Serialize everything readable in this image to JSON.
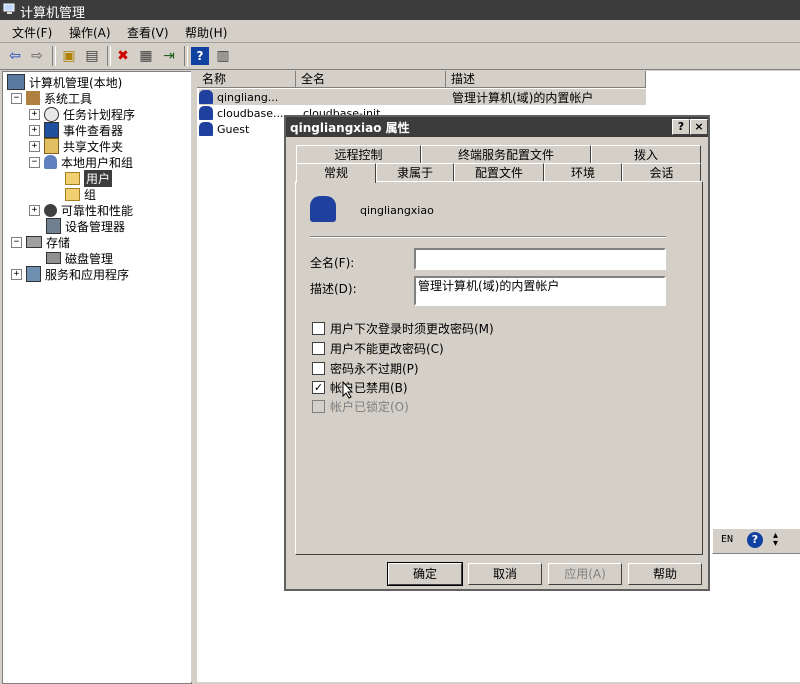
{
  "window": {
    "title": "计算机管理"
  },
  "menu": [
    "文件(F)",
    "操作(A)",
    "查看(V)",
    "帮助(H)"
  ],
  "toolbar": {
    "buttons": [
      {
        "name": "back-arrow-icon",
        "glyph": "⇦"
      },
      {
        "name": "forward-arrow-icon",
        "glyph": "⇨"
      },
      {
        "name": "up-folder-icon",
        "glyph": "▣"
      },
      {
        "name": "show-hide-tree-icon",
        "glyph": "▤"
      },
      {
        "name": "delete-icon",
        "glyph": "✖"
      },
      {
        "name": "properties-icon",
        "glyph": "▦"
      },
      {
        "name": "export-list-icon",
        "glyph": "⇥"
      },
      {
        "name": "help-icon",
        "glyph": "?"
      },
      {
        "name": "console-icon",
        "glyph": "▥"
      }
    ]
  },
  "tree": {
    "root": "计算机管理(本地)",
    "system_tools": "系统工具",
    "task_scheduler": "任务计划程序",
    "event_viewer": "事件查看器",
    "shared_folders": "共享文件夹",
    "local_users_groups": "本地用户和组",
    "users": "用户",
    "groups": "组",
    "reliability": "可靠性和性能",
    "device_manager": "设备管理器",
    "storage": "存储",
    "disk_management": "磁盘管理",
    "services_apps": "服务和应用程序"
  },
  "list": {
    "columns": [
      "名称",
      "全名",
      "描述"
    ],
    "rows": [
      {
        "name": "qingliang...",
        "fullname": "",
        "description": "管理计算机(域)的内置帐户"
      },
      {
        "name": "cloudbase...",
        "fullname": "cloudbase-init",
        "description": ""
      },
      {
        "name": "Guest",
        "fullname": "",
        "description": ""
      }
    ]
  },
  "dialog": {
    "title": "qingliangxiao 属性",
    "help_btn": "?",
    "close_btn": "×",
    "tabs_row1": [
      "远程控制",
      "终端服务配置文件",
      "拨入"
    ],
    "tabs_row2": [
      "常规",
      "隶属于",
      "配置文件",
      "环境",
      "会话"
    ],
    "username": "qingliangxiao",
    "fullname_label": "全名(F):",
    "fullname_value": "",
    "description_label": "描述(D):",
    "description_value": "管理计算机(域)的内置帐户",
    "checkboxes": [
      {
        "label": "用户下次登录时须更改密码(M)",
        "checked": false,
        "disabled": false
      },
      {
        "label": "用户不能更改密码(C)",
        "checked": false,
        "disabled": false
      },
      {
        "label": "密码永不过期(P)",
        "checked": false,
        "disabled": false
      },
      {
        "label": "帐户已禁用(B)",
        "checked": true,
        "disabled": false
      },
      {
        "label": "帐户已锁定(O)",
        "checked": false,
        "disabled": true
      }
    ],
    "buttons": {
      "ok": "确定",
      "cancel": "取消",
      "apply": "应用(A)",
      "help": "帮助"
    }
  },
  "langbar": {
    "lang": "EN",
    "help": "?"
  }
}
